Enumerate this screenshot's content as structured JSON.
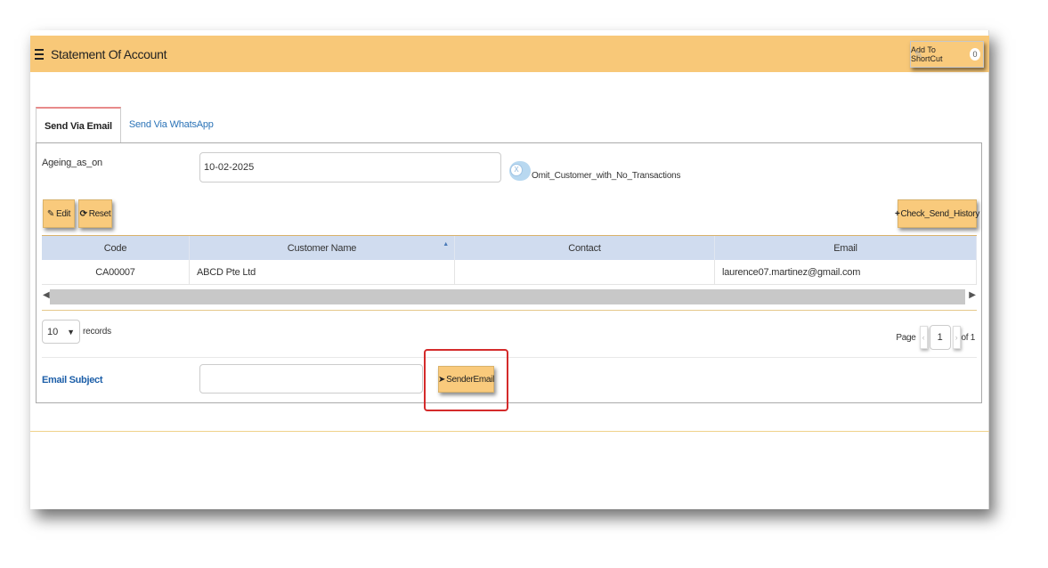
{
  "header": {
    "title": "Statement Of Account",
    "shortcut_label": "Add To ShortCut",
    "shortcut_count": "0"
  },
  "tabs": [
    {
      "label": "Send Via Email",
      "active": true
    },
    {
      "label": "Send Via WhatsApp",
      "active": false
    }
  ],
  "form": {
    "ageing_label": "Ageing_as_on",
    "ageing_value": "10-02-2025",
    "omit_label": "Omit_Customer_with_No_Transactions",
    "toggle_glyph": "X"
  },
  "toolbar": {
    "edit_label": "Edit",
    "reset_label": "Reset",
    "check_history_label": "Check_Send_History"
  },
  "grid": {
    "columns": [
      "Code",
      "Customer Name",
      "Contact",
      "Email"
    ],
    "rows": [
      {
        "code": "CA00007",
        "customer_name": "ABCD Pte Ltd",
        "contact": "",
        "email": "laurence07.martinez@gmail.com"
      }
    ]
  },
  "pagination": {
    "page_size": "10",
    "records_label": "records",
    "page_label": "Page",
    "current_page": "1",
    "of_label": "of 1"
  },
  "email": {
    "subject_label": "Email Subject",
    "subject_value": "",
    "send_label": "SenderEmail"
  },
  "colors": {
    "accent": "#f8c878",
    "highlight": "#d42b2b",
    "link": "#2b73b7"
  }
}
